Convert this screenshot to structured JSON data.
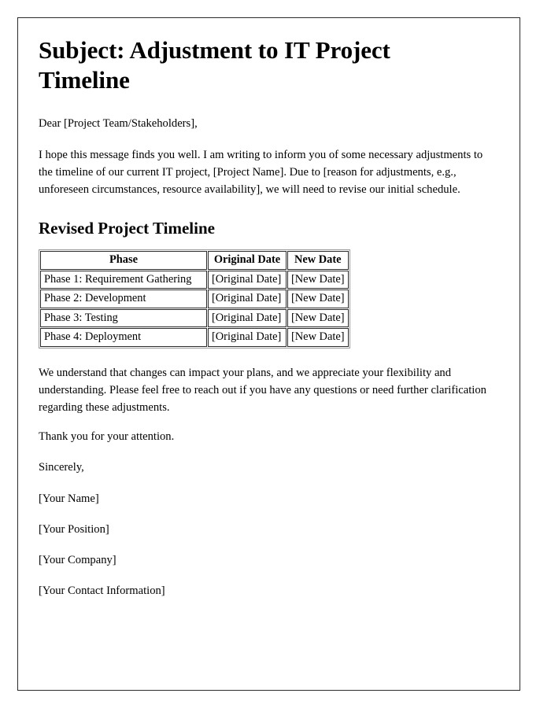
{
  "document": {
    "title": "Subject: Adjustment to IT Project Timeline",
    "salutation": "Dear [Project Team/Stakeholders],",
    "intro_paragraph": "I hope this message finds you well. I am writing to inform you of some necessary adjustments to the timeline of our current IT project, [Project Name]. Due to [reason for adjustments, e.g., unforeseen circumstances, resource availability], we will need to revise our initial schedule.",
    "section_heading": "Revised Project Timeline",
    "closing_paragraph": "We understand that changes can impact your plans, and we appreciate your flexibility and understanding. Please feel free to reach out if you have any questions or need further clarification regarding these adjustments.",
    "thank_you": "Thank you for your attention.",
    "sign_off": "Sincerely,",
    "signature": {
      "name": "[Your Name]",
      "position": "[Your Position]",
      "company": "[Your Company]",
      "contact": "[Your Contact Information]"
    }
  },
  "timeline_table": {
    "headers": {
      "phase": "Phase",
      "original_date": "Original Date",
      "new_date": "New Date"
    },
    "rows": [
      {
        "phase": "Phase 1: Requirement Gathering",
        "original_date": "[Original Date]",
        "new_date": "[New Date]"
      },
      {
        "phase": "Phase 2: Development",
        "original_date": "[Original Date]",
        "new_date": "[New Date]"
      },
      {
        "phase": "Phase 3: Testing",
        "original_date": "[Original Date]",
        "new_date": "[New Date]"
      },
      {
        "phase": "Phase 4: Deployment",
        "original_date": "[Original Date]",
        "new_date": "[New Date]"
      }
    ]
  },
  "colors": {
    "page_border": "#2b2b2b",
    "table_border": "#2b2b2b",
    "table_outer_border": "#9a9a9a",
    "text": "#000000",
    "background": "#ffffff"
  }
}
